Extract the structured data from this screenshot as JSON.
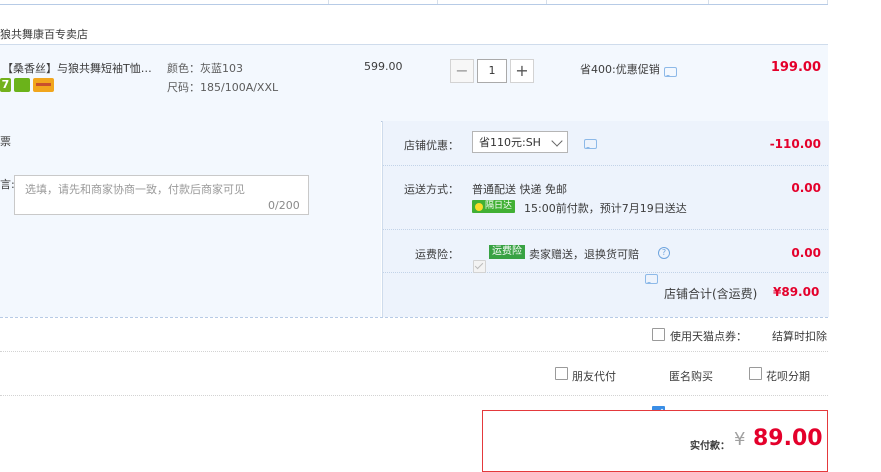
{
  "store": {
    "name": "狼共舞康百专卖店"
  },
  "item": {
    "title": "【桑香丝】与狼共舞短袖T恤男...",
    "service_icons": [
      "seven-day-return-icon",
      "guarantee-icon",
      "credit-card-icon"
    ],
    "service_7_text": "7",
    "sku_color": "颜色：灰蓝103",
    "sku_size": "尺码：185/100A/XXL",
    "price": "599.00",
    "quantity": "1",
    "qty_minus": "−",
    "qty_plus": "+",
    "promo": "省400:优惠促销",
    "total": "199.00"
  },
  "invoice": {
    "label": "票"
  },
  "message": {
    "label": "言:",
    "placeholder": "选填，请先和商家协商一致，付款后商家可见",
    "counter": "0/200"
  },
  "store_discount": {
    "label": "店铺优惠：",
    "selected": "省110元:SH",
    "amount": "-110.00"
  },
  "shipping": {
    "label": "运送方式：",
    "methods": "普通配送 快递 免邮",
    "badge": "隔日达",
    "eta": "15:00前付款，预计7月19日送达",
    "amount": "0.00"
  },
  "insurance": {
    "label": "运费险：",
    "badge": "运费险",
    "text": "卖家赠送，退换货可赔",
    "help": "?",
    "amount": "0.00"
  },
  "store_total": {
    "label": "店铺合计(含运费)",
    "value": "¥89.00"
  },
  "options": {
    "tmall_points": "使用天猫点券：",
    "settle_deduct": "结算时扣除",
    "friend_pay": "朋友代付",
    "anonymous": "匿名购买",
    "huabei": "花呗分期"
  },
  "payment": {
    "label": "实付款：",
    "currency": "¥",
    "value": "89.00"
  },
  "colors": {
    "accent_red": "#e4002b",
    "panel_blue": "#f3f8fe",
    "checkbox_blue": "#3a8ee6"
  }
}
